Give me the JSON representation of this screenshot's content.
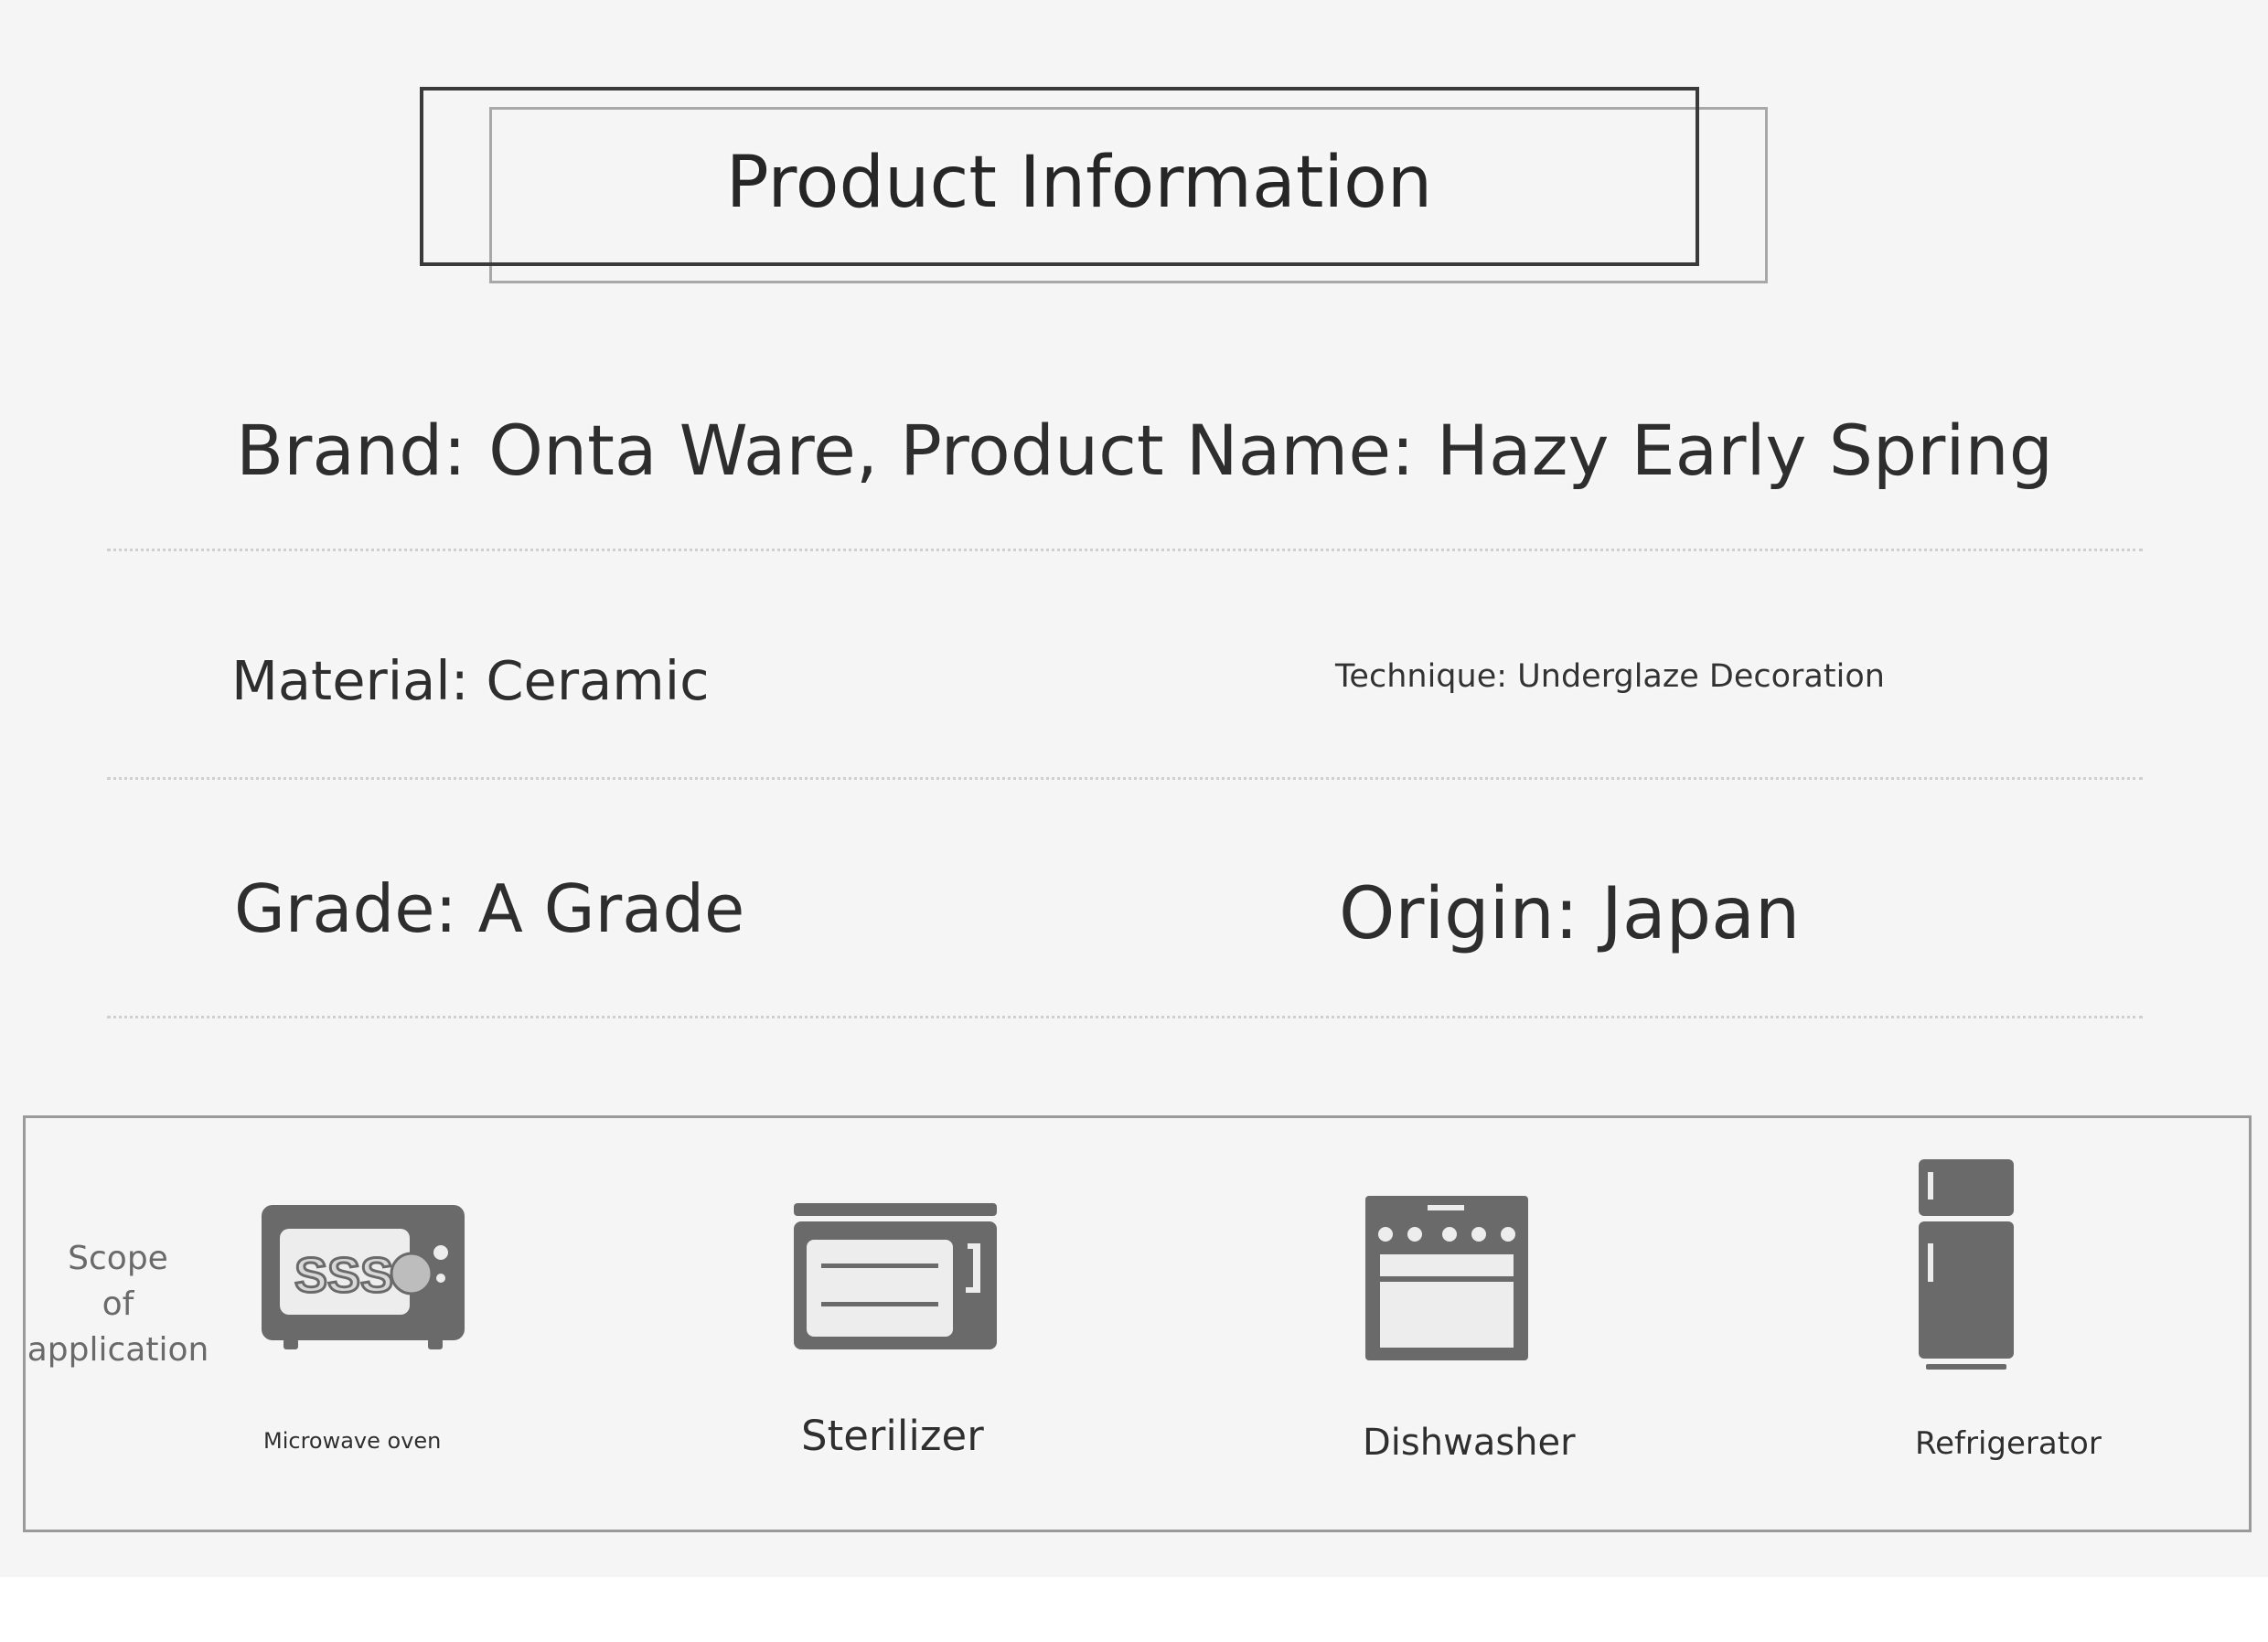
{
  "title": "Product Information",
  "rows": {
    "brand_line": "Brand: Onta Ware, Product Name: Hazy Early Spring",
    "material": "Material: Ceramic",
    "technique": "Technique: Underglaze Decoration",
    "grade": "Grade: A Grade",
    "origin": "Origin: Japan"
  },
  "scope": {
    "label_lines": [
      "Scope",
      "of",
      "application"
    ],
    "items": [
      {
        "label": "Microwave oven",
        "icon": "microwave-icon",
        "screen_text": "SSS"
      },
      {
        "label": "Sterilizer",
        "icon": "sterilizer-icon"
      },
      {
        "label": "Dishwasher",
        "icon": "dishwasher-icon"
      },
      {
        "label": "Refrigerator",
        "icon": "refrigerator-icon"
      }
    ]
  },
  "colors": {
    "background": "#f5f5f5",
    "text": "#2e2e2e",
    "icon": "#6a6a6a",
    "frame": "#3a3a3a"
  }
}
